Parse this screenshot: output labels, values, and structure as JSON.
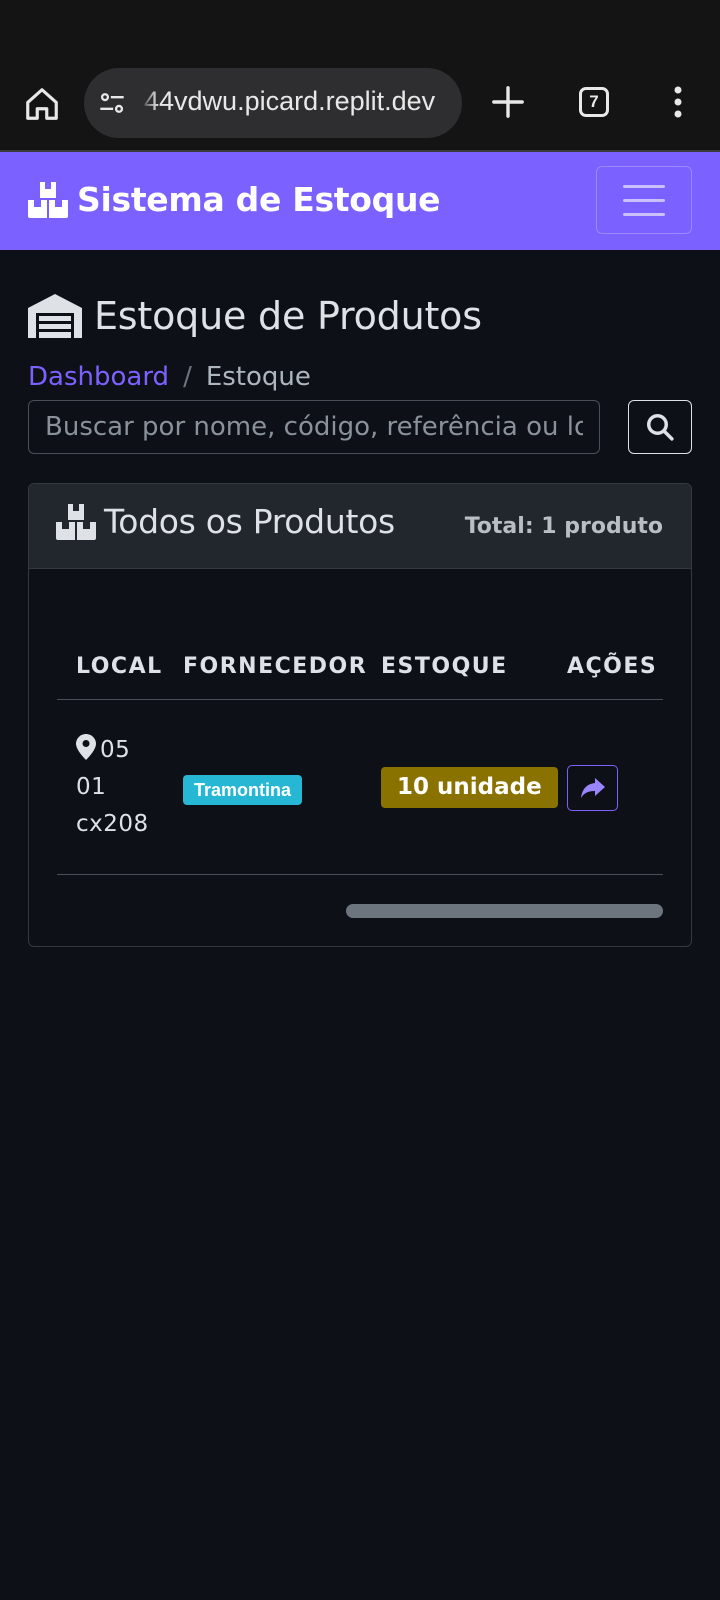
{
  "browser": {
    "url": "44vdwu.picard.replit.dev",
    "tab_count": "7"
  },
  "navbar": {
    "brand": "Sistema de Estoque"
  },
  "page": {
    "title": "Estoque de Produtos",
    "breadcrumb": {
      "home": "Dashboard",
      "current": "Estoque"
    },
    "search": {
      "placeholder": "Buscar por nome, código, referência ou local"
    }
  },
  "card": {
    "title": "Todos os Produtos",
    "total": "Total: 1 produto",
    "columns": [
      "LOCAL",
      "FORNECEDOR",
      "ESTOQUE",
      "AÇÕES"
    ],
    "rows": [
      {
        "local_lines": [
          "05",
          "01",
          "cx208"
        ],
        "supplier": "Tramontina",
        "stock": "10 unidade"
      }
    ]
  },
  "colors": {
    "accent": "#7b61ff",
    "background": "#0d1017",
    "supplier_badge": "#25b7d3",
    "stock_badge": "#8a7200"
  },
  "icons": {
    "brand": "boxes-icon",
    "title": "warehouse-icon",
    "search": "search-icon",
    "local": "map-marker-icon",
    "action": "share-icon"
  }
}
